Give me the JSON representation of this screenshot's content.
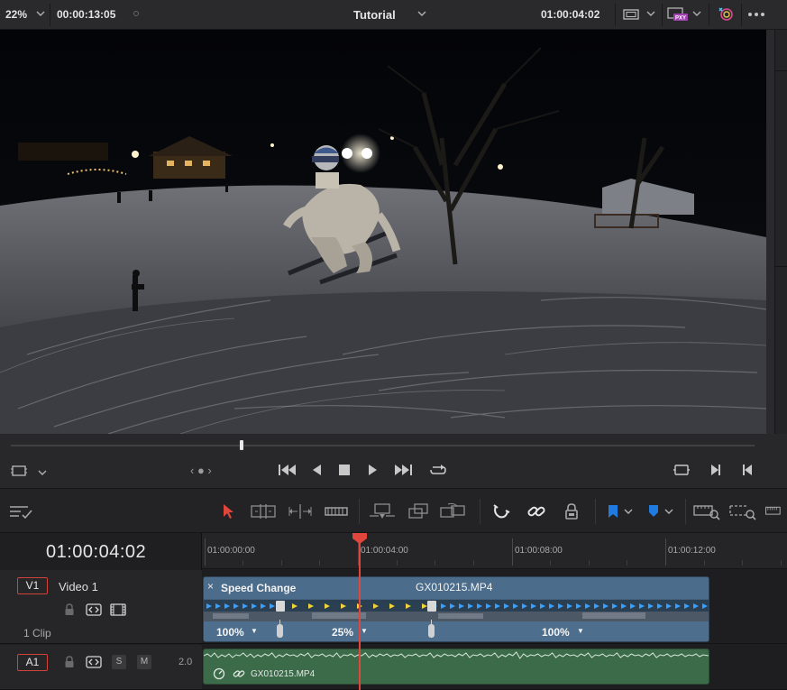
{
  "viewer_bar": {
    "zoom": "22%",
    "source_timecode": "00:00:13:05",
    "timeline_name": "Tutorial",
    "record_timecode": "01:00:04:02",
    "proxy_badge": "PXY"
  },
  "timeline": {
    "current_timecode": "01:00:04:02",
    "ruler_labels": [
      "01:00:00:00",
      "01:00:04:00",
      "01:00:08:00",
      "01:00:12:00"
    ],
    "tracks": {
      "video": {
        "tag": "V1",
        "name": "Video 1",
        "clip_count": "1 Clip",
        "clip": {
          "effect_label": "Speed Change",
          "close_glyph": "×",
          "file_name": "GX010215.MP4",
          "speed_segments": [
            {
              "label": "100%"
            },
            {
              "label": "25%"
            },
            {
              "label": "100%"
            }
          ]
        }
      },
      "audio": {
        "tag": "A1",
        "solo_label": "S",
        "mute_label": "M",
        "channel": "2.0",
        "clip": {
          "file_name": "GX010215.MP4"
        }
      }
    }
  },
  "transport": {
    "jog_glyph": "‹ ● ›"
  },
  "icons": {
    "viewer_bar": [
      "chevron-down-icon",
      "viewer-options-dot-icon",
      "chevron-down-icon",
      "viewer-size-icon",
      "proxy-icon",
      "color-wheel-icon",
      "more-options-icon"
    ],
    "transport": [
      "safe-area-icon",
      "go-to-start-icon",
      "play-reverse-icon",
      "stop-icon",
      "play-icon",
      "go-to-end-icon",
      "loop-icon",
      "match-frame-icon",
      "next-clip-icon",
      "previous-clip-icon"
    ],
    "timeline_toolbar": [
      "timeline-view-options-icon",
      "selection-tool-icon",
      "trim-edit-icon",
      "dynamic-trim-icon",
      "blade-icon",
      "insert-clip-icon",
      "overwrite-clip-icon",
      "replace-clip-icon",
      "snapping-icon",
      "linked-selection-icon",
      "position-lock-icon",
      "flag-icon",
      "marker-icon",
      "zoom-full-icon",
      "zoom-detail-icon",
      "zoom-custom-icon"
    ]
  },
  "colors": {
    "playhead": "#e0463c",
    "video_clip": "#44627e",
    "audio_clip": "#3c6b4a",
    "track_tag_border": "#d0433b",
    "flag_blue": "#1f7be0"
  }
}
